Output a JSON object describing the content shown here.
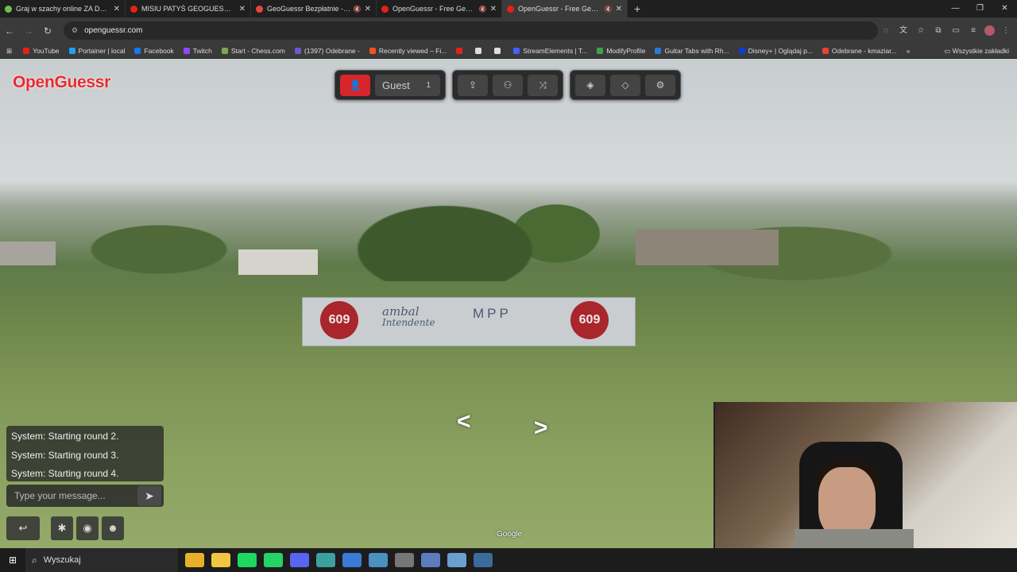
{
  "browser": {
    "tabs": [
      {
        "title": "Graj w szachy online ZA DARMO",
        "color": "#6fbf4a",
        "active": false
      },
      {
        "title": "MISIU PATYŚ GEOGUESSR - YouTube",
        "color": "#e62117",
        "active": false
      },
      {
        "title": "GeoGuessr Bezpłatnie - Gem",
        "color": "#e8453c",
        "active": false
      },
      {
        "title": "OpenGuessr - Free GeoGuessr",
        "color": "#e62117",
        "active": false
      },
      {
        "title": "OpenGuessr - Free GeoGuessr",
        "color": "#e62117",
        "active": true
      }
    ],
    "url": "openguessr.com",
    "bookmarks": [
      {
        "label": "YouTube",
        "color": "#e62117"
      },
      {
        "label": "Portainer | local",
        "color": "#1da1f2"
      },
      {
        "label": "Facebook",
        "color": "#1877f2"
      },
      {
        "label": "Twitch",
        "color": "#9146ff"
      },
      {
        "label": "Start - Chess.com",
        "color": "#7fa650"
      },
      {
        "label": "(1397) Odebrane -",
        "color": "#6a5acd"
      },
      {
        "label": "Recently viewed – Fi...",
        "color": "#f4511e"
      },
      {
        "label": "",
        "color": "#e62117"
      },
      {
        "label": "",
        "color": "#dddddd"
      },
      {
        "label": "",
        "color": "#dddddd"
      },
      {
        "label": "StreamElements | T...",
        "color": "#4a5cff"
      },
      {
        "label": "ModifyProfile",
        "color": "#3fa34d"
      },
      {
        "label": "Guitar Tabs with Rh...",
        "color": "#2a7ad5"
      },
      {
        "label": "Disney+ | Oglądaj p...",
        "color": "#113ccf"
      },
      {
        "label": "Odebrane - kmaziar...",
        "color": "#ea4335"
      }
    ],
    "all_bookmarks": "Wszystkie zakładki"
  },
  "game": {
    "logo": "OpenGuessr",
    "player_name": "Guest",
    "player_count": "1",
    "sign_text": "609",
    "wall_text_1": "ambal",
    "wall_text_2": "Intendente",
    "wall_text_3": "MPP",
    "chat_messages": [
      "System: Starting round 2.",
      "System: Starting round 3.",
      "System: Starting round 4."
    ],
    "chat_placeholder": "Type your message...",
    "google_label": "Google"
  },
  "taskbar": {
    "search_label": "Wyszukaj",
    "apps": [
      {
        "name": "chrome",
        "color": "#e6b127"
      },
      {
        "name": "explorer",
        "color": "#f3c543"
      },
      {
        "name": "spotify",
        "color": "#1ed760"
      },
      {
        "name": "whatsapp",
        "color": "#25d366"
      },
      {
        "name": "discord",
        "color": "#5865f2"
      },
      {
        "name": "app-5",
        "color": "#3aa0a0"
      },
      {
        "name": "app-6",
        "color": "#3b7bd8"
      },
      {
        "name": "app-7",
        "color": "#4a90c0"
      },
      {
        "name": "app-8",
        "color": "#777777"
      },
      {
        "name": "app-9",
        "color": "#5a7dbf"
      },
      {
        "name": "app-10",
        "color": "#6aa0d0"
      },
      {
        "name": "steam",
        "color": "#3c6a9a"
      }
    ]
  }
}
